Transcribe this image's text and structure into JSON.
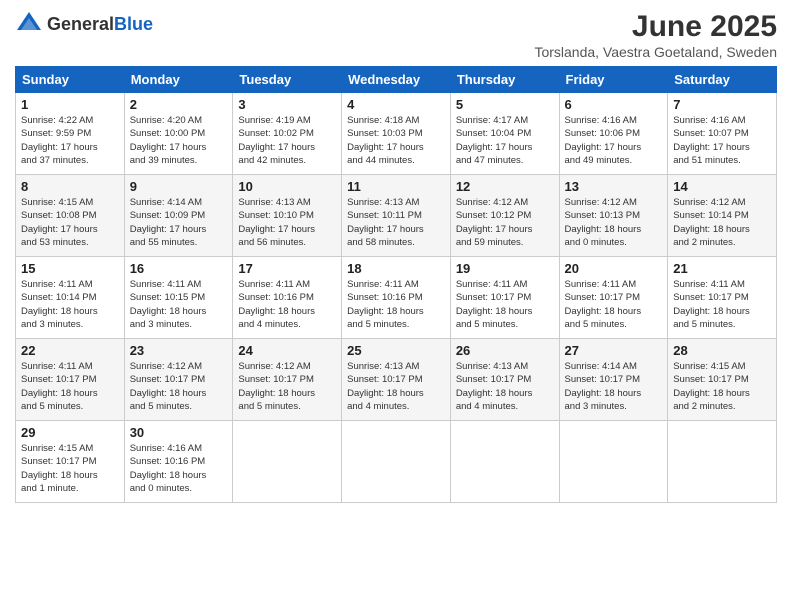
{
  "header": {
    "logo_general": "General",
    "logo_blue": "Blue",
    "month_title": "June 2025",
    "subtitle": "Torslanda, Vaestra Goetaland, Sweden"
  },
  "weekdays": [
    "Sunday",
    "Monday",
    "Tuesday",
    "Wednesday",
    "Thursday",
    "Friday",
    "Saturday"
  ],
  "weeks": [
    [
      {
        "day": "1",
        "info": "Sunrise: 4:22 AM\nSunset: 9:59 PM\nDaylight: 17 hours\nand 37 minutes."
      },
      {
        "day": "2",
        "info": "Sunrise: 4:20 AM\nSunset: 10:00 PM\nDaylight: 17 hours\nand 39 minutes."
      },
      {
        "day": "3",
        "info": "Sunrise: 4:19 AM\nSunset: 10:02 PM\nDaylight: 17 hours\nand 42 minutes."
      },
      {
        "day": "4",
        "info": "Sunrise: 4:18 AM\nSunset: 10:03 PM\nDaylight: 17 hours\nand 44 minutes."
      },
      {
        "day": "5",
        "info": "Sunrise: 4:17 AM\nSunset: 10:04 PM\nDaylight: 17 hours\nand 47 minutes."
      },
      {
        "day": "6",
        "info": "Sunrise: 4:16 AM\nSunset: 10:06 PM\nDaylight: 17 hours\nand 49 minutes."
      },
      {
        "day": "7",
        "info": "Sunrise: 4:16 AM\nSunset: 10:07 PM\nDaylight: 17 hours\nand 51 minutes."
      }
    ],
    [
      {
        "day": "8",
        "info": "Sunrise: 4:15 AM\nSunset: 10:08 PM\nDaylight: 17 hours\nand 53 minutes."
      },
      {
        "day": "9",
        "info": "Sunrise: 4:14 AM\nSunset: 10:09 PM\nDaylight: 17 hours\nand 55 minutes."
      },
      {
        "day": "10",
        "info": "Sunrise: 4:13 AM\nSunset: 10:10 PM\nDaylight: 17 hours\nand 56 minutes."
      },
      {
        "day": "11",
        "info": "Sunrise: 4:13 AM\nSunset: 10:11 PM\nDaylight: 17 hours\nand 58 minutes."
      },
      {
        "day": "12",
        "info": "Sunrise: 4:12 AM\nSunset: 10:12 PM\nDaylight: 17 hours\nand 59 minutes."
      },
      {
        "day": "13",
        "info": "Sunrise: 4:12 AM\nSunset: 10:13 PM\nDaylight: 18 hours\nand 0 minutes."
      },
      {
        "day": "14",
        "info": "Sunrise: 4:12 AM\nSunset: 10:14 PM\nDaylight: 18 hours\nand 2 minutes."
      }
    ],
    [
      {
        "day": "15",
        "info": "Sunrise: 4:11 AM\nSunset: 10:14 PM\nDaylight: 18 hours\nand 3 minutes."
      },
      {
        "day": "16",
        "info": "Sunrise: 4:11 AM\nSunset: 10:15 PM\nDaylight: 18 hours\nand 3 minutes."
      },
      {
        "day": "17",
        "info": "Sunrise: 4:11 AM\nSunset: 10:16 PM\nDaylight: 18 hours\nand 4 minutes."
      },
      {
        "day": "18",
        "info": "Sunrise: 4:11 AM\nSunset: 10:16 PM\nDaylight: 18 hours\nand 5 minutes."
      },
      {
        "day": "19",
        "info": "Sunrise: 4:11 AM\nSunset: 10:17 PM\nDaylight: 18 hours\nand 5 minutes."
      },
      {
        "day": "20",
        "info": "Sunrise: 4:11 AM\nSunset: 10:17 PM\nDaylight: 18 hours\nand 5 minutes."
      },
      {
        "day": "21",
        "info": "Sunrise: 4:11 AM\nSunset: 10:17 PM\nDaylight: 18 hours\nand 5 minutes."
      }
    ],
    [
      {
        "day": "22",
        "info": "Sunrise: 4:11 AM\nSunset: 10:17 PM\nDaylight: 18 hours\nand 5 minutes."
      },
      {
        "day": "23",
        "info": "Sunrise: 4:12 AM\nSunset: 10:17 PM\nDaylight: 18 hours\nand 5 minutes."
      },
      {
        "day": "24",
        "info": "Sunrise: 4:12 AM\nSunset: 10:17 PM\nDaylight: 18 hours\nand 5 minutes."
      },
      {
        "day": "25",
        "info": "Sunrise: 4:13 AM\nSunset: 10:17 PM\nDaylight: 18 hours\nand 4 minutes."
      },
      {
        "day": "26",
        "info": "Sunrise: 4:13 AM\nSunset: 10:17 PM\nDaylight: 18 hours\nand 4 minutes."
      },
      {
        "day": "27",
        "info": "Sunrise: 4:14 AM\nSunset: 10:17 PM\nDaylight: 18 hours\nand 3 minutes."
      },
      {
        "day": "28",
        "info": "Sunrise: 4:15 AM\nSunset: 10:17 PM\nDaylight: 18 hours\nand 2 minutes."
      }
    ],
    [
      {
        "day": "29",
        "info": "Sunrise: 4:15 AM\nSunset: 10:17 PM\nDaylight: 18 hours\nand 1 minute."
      },
      {
        "day": "30",
        "info": "Sunrise: 4:16 AM\nSunset: 10:16 PM\nDaylight: 18 hours\nand 0 minutes."
      },
      null,
      null,
      null,
      null,
      null
    ]
  ]
}
